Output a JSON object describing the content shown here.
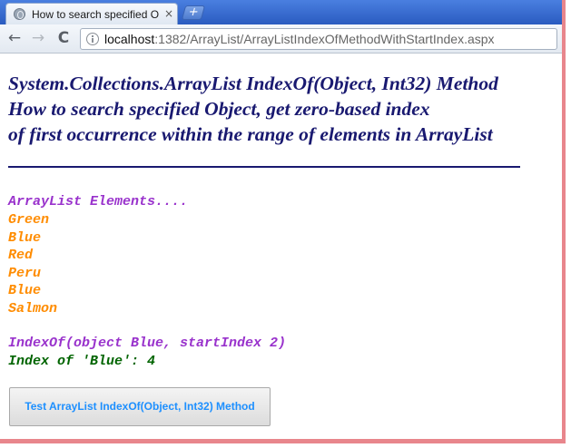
{
  "browser": {
    "tab_title": "How to search specified Ob",
    "tab_close": "×",
    "new_tab": "+",
    "back": "←",
    "forward": "→",
    "reload": "C",
    "url_host": "localhost",
    "url_path": ":1382/ArrayList/ArrayListIndexOfMethodWithStartIndex.aspx"
  },
  "page": {
    "heading_lines": [
      "System.Collections.ArrayList IndexOf(Object, Int32) Method",
      "How to search specified Object, get zero-based index",
      "of first occurrence within the range of elements in ArrayList"
    ],
    "list_title": "ArrayList Elements....",
    "items": [
      "Green",
      "Blue",
      "Red",
      "Peru",
      "Blue",
      "Salmon"
    ],
    "query_text": "IndexOf(object Blue, startIndex 2)",
    "result_text": "Index of 'Blue': 4",
    "button_label": "Test ArrayList IndexOf(Object, Int32) Method"
  },
  "colors": {
    "heading": "#191970",
    "list_title": "#9932cc",
    "items": "#ff8c00",
    "result": "#006400",
    "button_text": "#1e90ff",
    "frame": "#e8868c"
  }
}
